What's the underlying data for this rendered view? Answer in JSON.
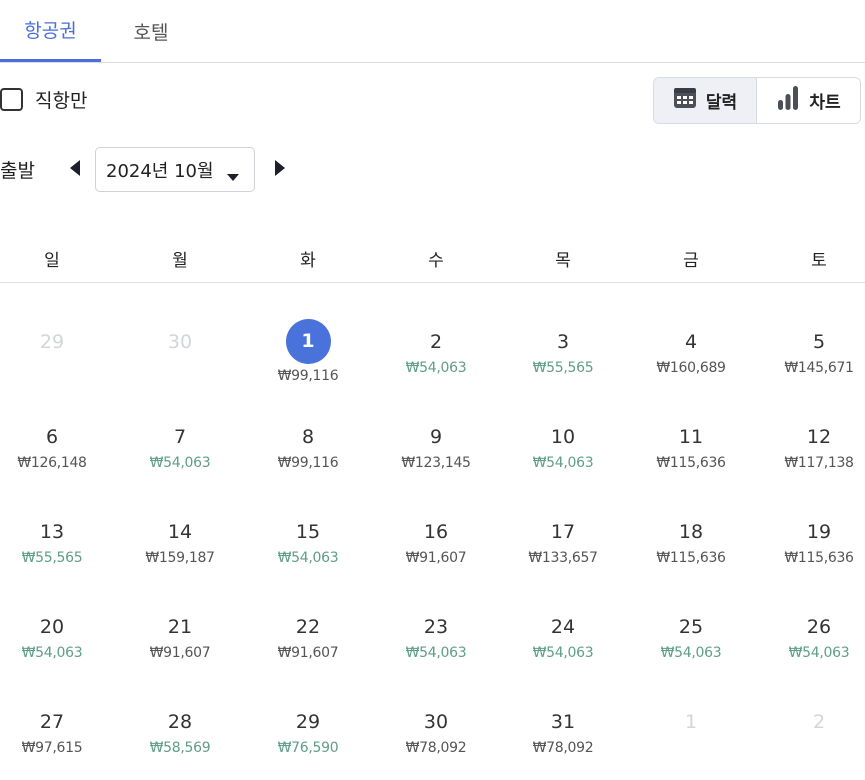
{
  "tabs": {
    "flight": "항공권",
    "hotel": "호텔"
  },
  "filters": {
    "direct_only": "직항만",
    "direct_checked": false
  },
  "view_toggle": {
    "calendar": "달력",
    "chart": "차트",
    "selected": "calendar"
  },
  "departure": {
    "label": "출발",
    "month": "2024년 10월"
  },
  "weekdays": [
    "일",
    "월",
    "화",
    "수",
    "목",
    "금",
    "토"
  ],
  "colors": {
    "accent": "#4a6fd8",
    "selected_day": "#4a72db",
    "low_price": "#5f9e86",
    "normal_price": "#555555",
    "muted_day": "#d3d5da"
  },
  "calendar": {
    "weeks": [
      [
        {
          "day": "29",
          "price": "",
          "muted": true
        },
        {
          "day": "30",
          "price": "",
          "muted": true
        },
        {
          "day": "1",
          "price": "₩99,116",
          "selected": true
        },
        {
          "day": "2",
          "price": "₩54,063",
          "low": true
        },
        {
          "day": "3",
          "price": "₩55,565",
          "low": true
        },
        {
          "day": "4",
          "price": "₩160,689"
        },
        {
          "day": "5",
          "price": "₩145,671"
        }
      ],
      [
        {
          "day": "6",
          "price": "₩126,148"
        },
        {
          "day": "7",
          "price": "₩54,063",
          "low": true
        },
        {
          "day": "8",
          "price": "₩99,116"
        },
        {
          "day": "9",
          "price": "₩123,145"
        },
        {
          "day": "10",
          "price": "₩54,063",
          "low": true
        },
        {
          "day": "11",
          "price": "₩115,636"
        },
        {
          "day": "12",
          "price": "₩117,138"
        }
      ],
      [
        {
          "day": "13",
          "price": "₩55,565",
          "low": true
        },
        {
          "day": "14",
          "price": "₩159,187"
        },
        {
          "day": "15",
          "price": "₩54,063",
          "low": true
        },
        {
          "day": "16",
          "price": "₩91,607"
        },
        {
          "day": "17",
          "price": "₩133,657"
        },
        {
          "day": "18",
          "price": "₩115,636"
        },
        {
          "day": "19",
          "price": "₩115,636"
        }
      ],
      [
        {
          "day": "20",
          "price": "₩54,063",
          "low": true
        },
        {
          "day": "21",
          "price": "₩91,607"
        },
        {
          "day": "22",
          "price": "₩91,607"
        },
        {
          "day": "23",
          "price": "₩54,063",
          "low": true
        },
        {
          "day": "24",
          "price": "₩54,063",
          "low": true
        },
        {
          "day": "25",
          "price": "₩54,063",
          "low": true
        },
        {
          "day": "26",
          "price": "₩54,063",
          "low": true
        }
      ],
      [
        {
          "day": "27",
          "price": "₩97,615"
        },
        {
          "day": "28",
          "price": "₩58,569",
          "low": true
        },
        {
          "day": "29",
          "price": "₩76,590",
          "low": true
        },
        {
          "day": "30",
          "price": "₩78,092"
        },
        {
          "day": "31",
          "price": "₩78,092"
        },
        {
          "day": "1",
          "price": "",
          "muted": true
        },
        {
          "day": "2",
          "price": "",
          "muted": true
        }
      ]
    ]
  }
}
